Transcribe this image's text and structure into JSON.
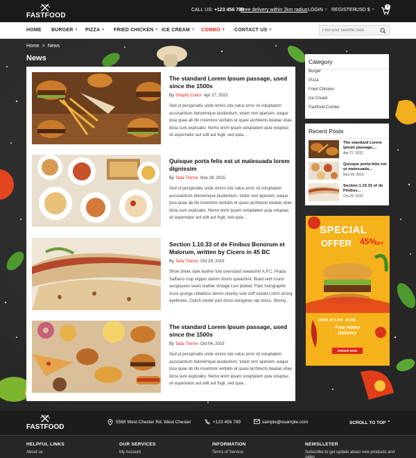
{
  "header": {
    "logo_text": "FASTFOOD",
    "call_label": "CALL US:",
    "call_number": "+123 456 789",
    "delivery_text": "Free delivery within 2km radius",
    "login": "LOGIN",
    "register": "REGISTER",
    "currency": "USD $",
    "cart_count": "0"
  },
  "nav": {
    "items": [
      {
        "label": "HOME"
      },
      {
        "label": "BURGER"
      },
      {
        "label": "PIZZA"
      },
      {
        "label": "FRIED CHICKEN"
      },
      {
        "label": "ICE CREAM"
      },
      {
        "label": "COMBO"
      },
      {
        "label": "CONTACT US"
      }
    ],
    "search_placeholder": "Find your favorite food"
  },
  "breadcrumb": {
    "home": "Home",
    "separator": ">",
    "current": "News"
  },
  "page_title": "News",
  "posts": [
    {
      "title": "The standard Lorem Ipsum passage, used since the 1500s",
      "by": "By",
      "author": "Shopify Codor",
      "date": "Apr 27, 2022",
      "excerpt": "Sed ut perspiciatis unde omnis iste natus error sit voluptatem accusantium doloremque laudantium, totam rem aperiam, eaque ipsa quae ab illo inventore veritatis et quasi architecto beatae vitae dicta sunt explicabo. Nemo enim ipsam voluptatem quia voluptas sit aspernatur aut odit aut fugit, sed quia..."
    },
    {
      "title": "Quisque porta felis est ut malesuada lorem dignissim",
      "by": "By",
      "author": "Tada Theme",
      "date": "Nov 29, 2015",
      "excerpt": "Sed ut perspiciatis unde omnis iste natus error sit voluptatem accusantium doloremque laudantium, totam rem aperiam, eaque ipsa quae ab illo inventore veritatis et quasi architecto beatae vitae dicta sunt explicabo. Nemo enim ipsam voluptatem quia voluptas sit aspernatur aut odit aut fugit, sed quia..."
    },
    {
      "title": "Section 1.10.33 of de Finibus Bonorum et Malorum, written by Cicero in 45 BC",
      "by": "By",
      "author": "Tada Theme",
      "date": "Oct 29, 2015",
      "excerpt": "Shoe street style leather tote oversized sweatshirt A.P.C. Prada Saffiano crop slipper denim shorts spearmint. Braid skirt round sunglasses seam leather vintage Levi plaited. Flats holographic Acne grunge collarless denim chunky sole cuff tucked t-shirt strong eyebrows. Clutch center part dress dungaree slip dress. Skinny..."
    },
    {
      "title": "The standard Lorem Ipsum passage, used since the 1500s",
      "by": "By",
      "author": "Tada Theme",
      "date": "Oct 04, 2015",
      "excerpt": "Sed ut perspiciatis unde omnis iste natus error sit voluptatem accusantium doloremque laudantium, totam rem aperiam, eaque ipsa quae ab illo inventore veritatis et quasi architecto beatae vitae dicta sunt explicabo. Nemo enim ipsam voluptatem quia voluptas sit aspernatur aut odit aut fugit, sed quia..."
    }
  ],
  "sidebar": {
    "category_title": "Category",
    "categories": [
      "Burger",
      "Pizza",
      "Fried Chicken",
      "Ice Cream",
      "Fastfood Combo"
    ],
    "recent_title": "Recent Posts",
    "recent": [
      {
        "title": "The standard Lorem Ipsum passage,...",
        "date": "Apr 27, 2022"
      },
      {
        "title": "Quisque porta felis est ut malesuada...",
        "date": "Nov 29, 2015"
      },
      {
        "title": "Section 1.10.33 of de Finibus...",
        "date": "Oct 29, 2015"
      }
    ],
    "promo": {
      "line1": "SPECIAL",
      "line2": "OFFER",
      "percent": "45%",
      "off": "OFF",
      "hours": "OPEN AT 9 AM - 10 PM",
      "free_delivery": "Free Home Delivery",
      "order_button": "ORDER NOW"
    }
  },
  "footer": {
    "logo_text": "FASTFOOD",
    "address": "5568 West Chester Rd. West Chester",
    "phone": "+123 456 789",
    "email": "sample@example.com",
    "scroll_top": "SCROLL TO TOP",
    "columns": [
      {
        "heading": "HELPFUL LINKS",
        "first_link": "About us"
      },
      {
        "heading": "OUR SERVICES",
        "first_link": "My Account"
      },
      {
        "heading": "INFORMATION",
        "first_link": "Terms of Service"
      },
      {
        "heading": "NEWSLLETER",
        "first_link": "Subscribe to get update about new products and sales"
      }
    ]
  },
  "colors": {
    "accent": "#e2231a",
    "dark": "#1a1a1a",
    "promo": "#f5b21a"
  }
}
